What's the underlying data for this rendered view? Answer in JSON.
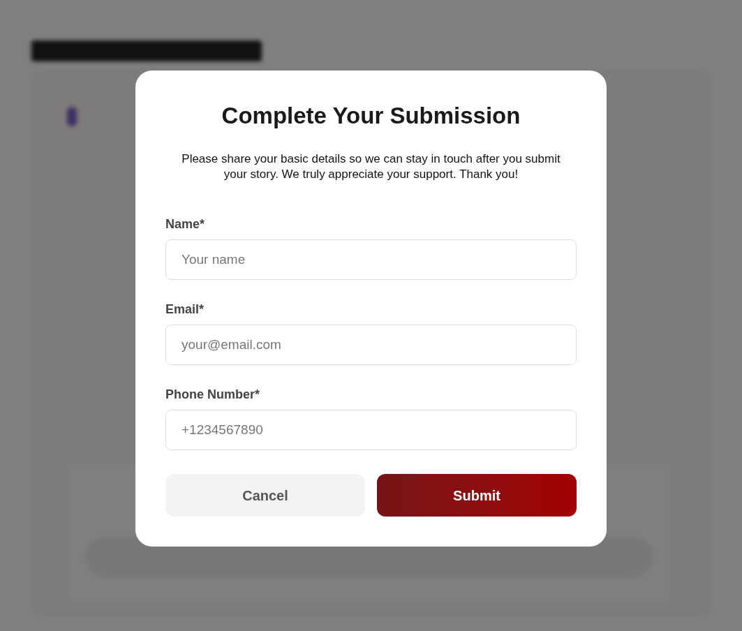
{
  "modal": {
    "title": "Complete Your Submission",
    "description": "Please share your basic details so we can stay in touch after you submit your story. We truly appreciate your support. Thank you!",
    "fields": [
      {
        "label": "Name*",
        "placeholder": "Your name"
      },
      {
        "label": "Email*",
        "placeholder": "your@email.com"
      },
      {
        "label": "Phone Number*",
        "placeholder": "+1234567890"
      }
    ],
    "buttons": [
      {
        "label": "Cancel",
        "kind": "secondary"
      },
      {
        "label": "Submit",
        "kind": "primary"
      }
    ]
  }
}
